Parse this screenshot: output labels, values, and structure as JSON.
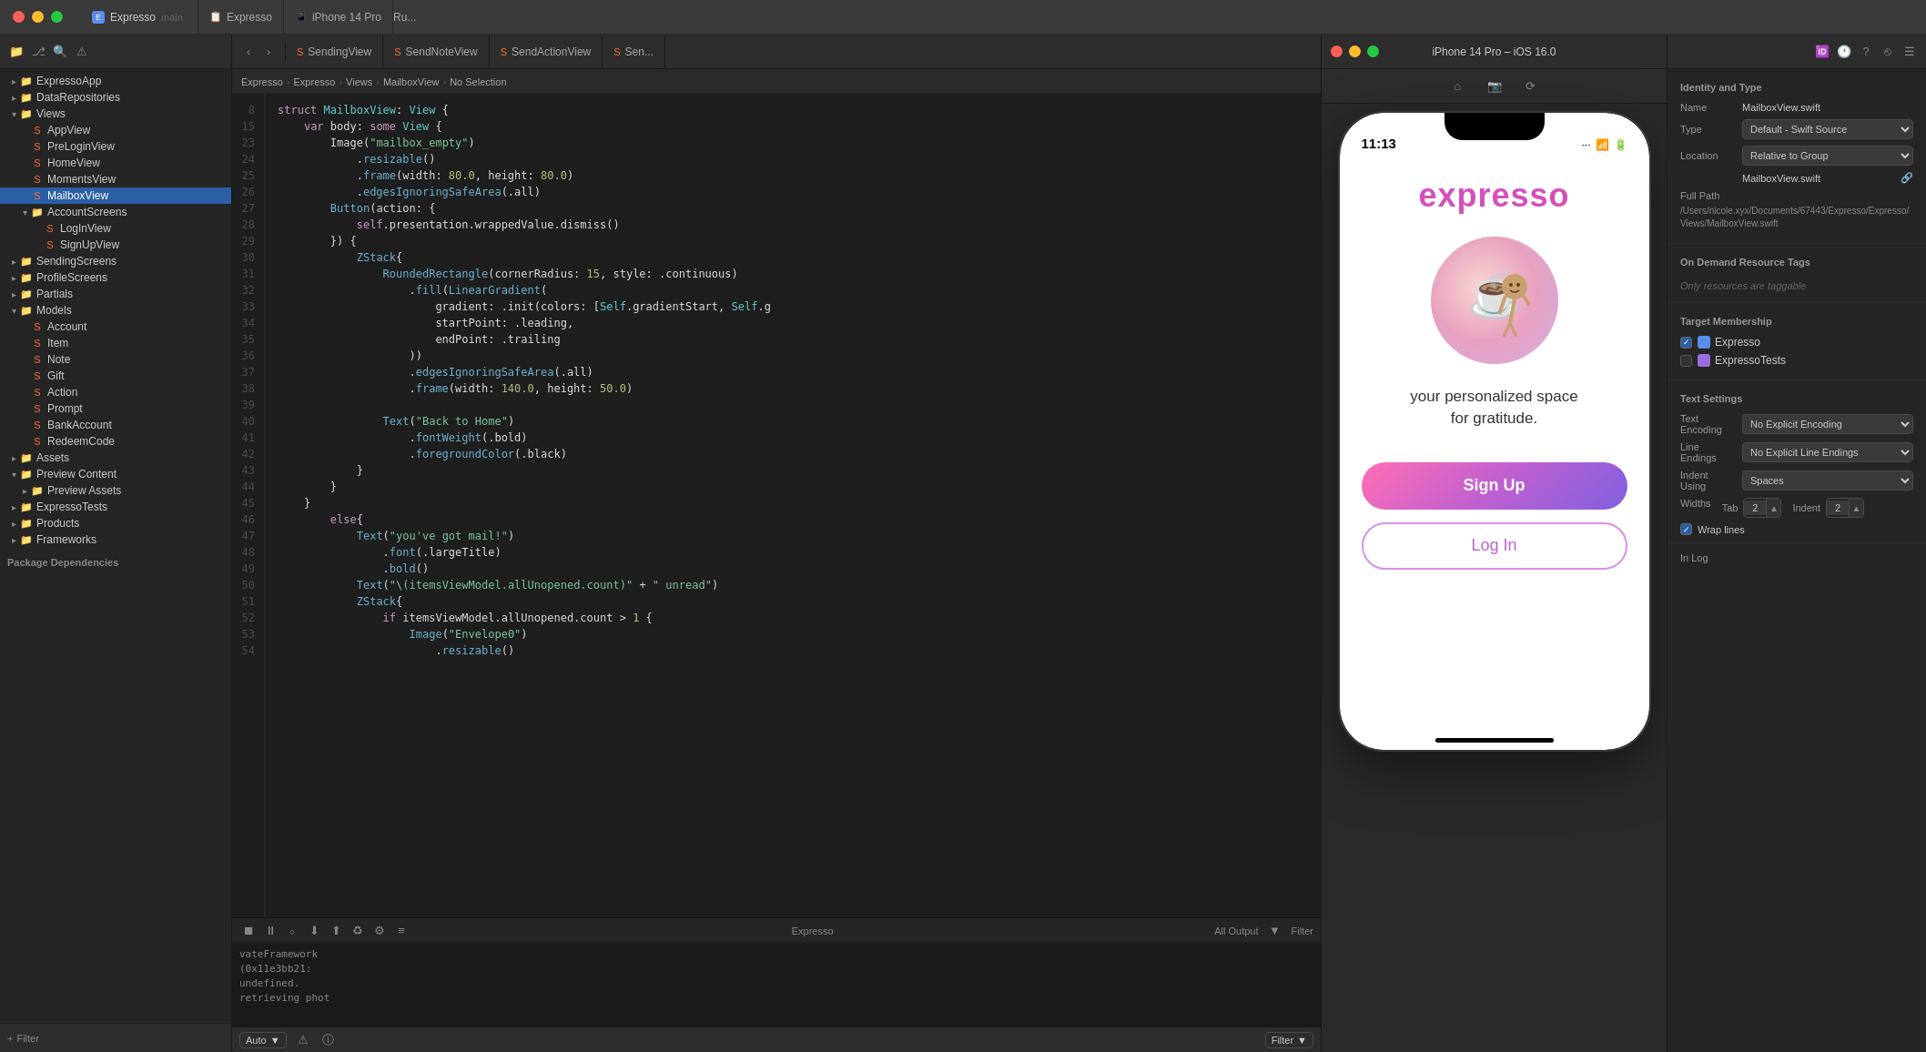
{
  "titleBar": {
    "project": {
      "name": "Expresso",
      "branch": "main",
      "icon": "E"
    },
    "tabs": [
      {
        "label": "Expresso",
        "icon": "📋"
      },
      {
        "label": "iPhone 14 Pro",
        "icon": "📱"
      }
    ],
    "runLabel": "Ru..."
  },
  "leftSidebar": {
    "toolbar": {
      "icons": [
        "folder-icon",
        "git-icon",
        "search-icon",
        "warning-icon"
      ]
    },
    "tree": [
      {
        "label": "ExpressoApp",
        "type": "folder",
        "depth": 0,
        "expanded": false
      },
      {
        "label": "DataRepositories",
        "type": "folder",
        "depth": 0,
        "expanded": false
      },
      {
        "label": "Views",
        "type": "folder",
        "depth": 0,
        "expanded": true
      },
      {
        "label": "AppView",
        "type": "swift",
        "depth": 1
      },
      {
        "label": "PreLoginView",
        "type": "swift",
        "depth": 1
      },
      {
        "label": "HomeView",
        "type": "swift",
        "depth": 1
      },
      {
        "label": "MomentsView",
        "type": "swift",
        "depth": 1
      },
      {
        "label": "MailboxView",
        "type": "swift",
        "depth": 1,
        "selected": true
      },
      {
        "label": "AccountScreens",
        "type": "folder",
        "depth": 1,
        "expanded": true
      },
      {
        "label": "LogInView",
        "type": "swift",
        "depth": 2
      },
      {
        "label": "SignUpView",
        "type": "swift",
        "depth": 2
      },
      {
        "label": "SendingScreens",
        "type": "folder",
        "depth": 0,
        "expanded": false
      },
      {
        "label": "ProfileScreens",
        "type": "folder",
        "depth": 0,
        "expanded": false
      },
      {
        "label": "Partials",
        "type": "folder",
        "depth": 0,
        "expanded": false
      },
      {
        "label": "Models",
        "type": "folder",
        "depth": 0,
        "expanded": true
      },
      {
        "label": "Account",
        "type": "swift",
        "depth": 1
      },
      {
        "label": "Item",
        "type": "swift",
        "depth": 1
      },
      {
        "label": "Note",
        "type": "swift",
        "depth": 1
      },
      {
        "label": "Gift",
        "type": "swift",
        "depth": 1
      },
      {
        "label": "Action",
        "type": "swift",
        "depth": 1
      },
      {
        "label": "Prompt",
        "type": "swift",
        "depth": 1
      },
      {
        "label": "BankAccount",
        "type": "swift",
        "depth": 1
      },
      {
        "label": "RedeemCode",
        "type": "swift",
        "depth": 1
      },
      {
        "label": "Assets",
        "type": "folder",
        "depth": 0,
        "expanded": false
      },
      {
        "label": "Preview Content",
        "type": "folder",
        "depth": 0,
        "expanded": true
      },
      {
        "label": "Preview Assets",
        "type": "folder",
        "depth": 1,
        "expanded": false
      },
      {
        "label": "ExpressoTests",
        "type": "folder",
        "depth": 0,
        "expanded": false
      },
      {
        "label": "Products",
        "type": "folder",
        "depth": 0,
        "expanded": false
      },
      {
        "label": "Frameworks",
        "type": "folder",
        "depth": 0,
        "expanded": false
      }
    ],
    "footer": {
      "addLabel": "+ Filter",
      "filterLabel": "Filter"
    }
  },
  "editor": {
    "tabs": [
      {
        "label": "SendingView",
        "icon": "S"
      },
      {
        "label": "SendNoteView",
        "icon": "S"
      },
      {
        "label": "SendActionView",
        "icon": "S"
      },
      {
        "label": "Sen...",
        "icon": "S"
      }
    ],
    "breadcrumb": [
      "Expresso",
      "Expresso",
      "Views",
      "MailboxView",
      "No Selection"
    ],
    "lines": [
      {
        "num": "8",
        "code": "struct MailboxView: View {",
        "tokens": [
          {
            "t": "kw",
            "v": "struct "
          },
          {
            "t": "type",
            "v": "MailboxView"
          },
          {
            "t": "plain",
            "v": ": "
          },
          {
            "t": "type",
            "v": "View"
          },
          {
            "t": "plain",
            "v": " {"
          }
        ]
      },
      {
        "num": "15",
        "code": "    var body: some View {",
        "tokens": [
          {
            "t": "plain",
            "v": "    "
          },
          {
            "t": "kw",
            "v": "var "
          },
          {
            "t": "plain",
            "v": "body: "
          },
          {
            "t": "kw",
            "v": "some "
          },
          {
            "t": "type",
            "v": "View"
          },
          {
            "t": "plain",
            "v": " {"
          }
        ]
      },
      {
        "num": "23",
        "code": "        Image(\"mailbox_empty\")",
        "tokens": [
          {
            "t": "plain",
            "v": "        "
          },
          {
            "t": "fn",
            "v": "Image"
          },
          {
            "t": "plain",
            "v": "("
          },
          {
            "t": "str",
            "v": "\"mailbox_empty\""
          },
          {
            "t": "plain",
            "v": ")"
          }
        ]
      },
      {
        "num": "24",
        "code": "            .resizable()",
        "tokens": [
          {
            "t": "plain",
            "v": "            ."
          },
          {
            "t": "fn",
            "v": "resizable"
          },
          {
            "t": "plain",
            "v": "()"
          }
        ]
      },
      {
        "num": "25",
        "code": "            .frame(width: 80.0, height: 80.0)",
        "tokens": [
          {
            "t": "plain",
            "v": "            ."
          },
          {
            "t": "fn",
            "v": "frame"
          },
          {
            "t": "plain",
            "v": "(width: "
          },
          {
            "t": "num",
            "v": "80.0"
          },
          {
            "t": "plain",
            "v": ", height: "
          },
          {
            "t": "num",
            "v": "80.0"
          },
          {
            "t": "plain",
            "v": ")"
          }
        ]
      },
      {
        "num": "26",
        "code": "            .edgesIgnoringSafeArea(.all)",
        "tokens": [
          {
            "t": "plain",
            "v": "            ."
          },
          {
            "t": "fn",
            "v": "edgesIgnoringSafeArea"
          },
          {
            "t": "plain",
            "v": "(.all)"
          }
        ]
      },
      {
        "num": "27",
        "code": "        Button(action: {",
        "tokens": [
          {
            "t": "plain",
            "v": "        "
          },
          {
            "t": "fn",
            "v": "Button"
          },
          {
            "t": "plain",
            "v": "(action: {"
          }
        ]
      },
      {
        "num": "28",
        "code": "            self.presentation.wrappedValue.dismiss()",
        "tokens": [
          {
            "t": "plain",
            "v": "            "
          },
          {
            "t": "kw",
            "v": "self"
          },
          {
            "t": "plain",
            "v": ".presentation.wrappedValue.dismiss()"
          }
        ]
      },
      {
        "num": "29",
        "code": "        }) {",
        "tokens": [
          {
            "t": "plain",
            "v": "        }) {"
          }
        ]
      },
      {
        "num": "30",
        "code": "            ZStack{",
        "tokens": [
          {
            "t": "plain",
            "v": "            "
          },
          {
            "t": "fn",
            "v": "ZStack"
          },
          {
            "t": "plain",
            "v": "{"
          }
        ]
      },
      {
        "num": "31",
        "code": "                RoundedRectangle(cornerRadius: 15, style: .continuous)",
        "tokens": [
          {
            "t": "plain",
            "v": "                "
          },
          {
            "t": "fn",
            "v": "RoundedRectangle"
          },
          {
            "t": "plain",
            "v": "(cornerRadius: "
          },
          {
            "t": "num",
            "v": "15"
          },
          {
            "t": "plain",
            "v": ", style: .continuous)"
          }
        ]
      },
      {
        "num": "32",
        "code": "                    .fill(LinearGradient(",
        "tokens": [
          {
            "t": "plain",
            "v": "                    ."
          },
          {
            "t": "fn",
            "v": "fill"
          },
          {
            "t": "plain",
            "v": "("
          },
          {
            "t": "fn",
            "v": "LinearGradient"
          },
          {
            "t": "plain",
            "v": "("
          }
        ]
      },
      {
        "num": "33",
        "code": "                        gradient: .init(colors: [Self.gradientStart, Self.g",
        "tokens": [
          {
            "t": "plain",
            "v": "                        gradient: .init(colors: ["
          },
          {
            "t": "type",
            "v": "Self"
          },
          {
            "t": "plain",
            "v": ".gradientStart, "
          },
          {
            "t": "type",
            "v": "Self"
          },
          {
            "t": "plain",
            "v": ".g"
          }
        ]
      },
      {
        "num": "34",
        "code": "                        startPoint: .leading,",
        "tokens": [
          {
            "t": "plain",
            "v": "                        startPoint: .leading,"
          }
        ]
      },
      {
        "num": "35",
        "code": "                        endPoint: .trailing",
        "tokens": [
          {
            "t": "plain",
            "v": "                        endPoint: .trailing"
          }
        ]
      },
      {
        "num": "36",
        "code": "                    ))",
        "tokens": [
          {
            "t": "plain",
            "v": "                    ))"
          }
        ]
      },
      {
        "num": "37",
        "code": "                    .edgesIgnoringSafeArea(.all)",
        "tokens": [
          {
            "t": "plain",
            "v": "                    ."
          },
          {
            "t": "fn",
            "v": "edgesIgnoringSafeArea"
          },
          {
            "t": "plain",
            "v": "(.all)"
          }
        ]
      },
      {
        "num": "38",
        "code": "                    .frame(width: 140.0, height: 50.0)",
        "tokens": [
          {
            "t": "plain",
            "v": "                    ."
          },
          {
            "t": "fn",
            "v": "frame"
          },
          {
            "t": "plain",
            "v": "(width: "
          },
          {
            "t": "num",
            "v": "140.0"
          },
          {
            "t": "plain",
            "v": ", height: "
          },
          {
            "t": "num",
            "v": "50.0"
          },
          {
            "t": "plain",
            "v": ")"
          }
        ]
      },
      {
        "num": "39",
        "code": "",
        "tokens": []
      },
      {
        "num": "40",
        "code": "                Text(\"Back to Home\")",
        "tokens": [
          {
            "t": "plain",
            "v": "                "
          },
          {
            "t": "fn",
            "v": "Text"
          },
          {
            "t": "plain",
            "v": "("
          },
          {
            "t": "str",
            "v": "\"Back to Home\""
          },
          {
            "t": "plain",
            "v": ")"
          }
        ]
      },
      {
        "num": "41",
        "code": "                    .fontWeight(.bold)",
        "tokens": [
          {
            "t": "plain",
            "v": "                    ."
          },
          {
            "t": "fn",
            "v": "fontWeight"
          },
          {
            "t": "plain",
            "v": "(.bold)"
          }
        ]
      },
      {
        "num": "42",
        "code": "                    .foregroundColor(.black)",
        "tokens": [
          {
            "t": "plain",
            "v": "                    ."
          },
          {
            "t": "fn",
            "v": "foregroundColor"
          },
          {
            "t": "plain",
            "v": "(.black)"
          }
        ]
      },
      {
        "num": "43",
        "code": "            }",
        "tokens": [
          {
            "t": "plain",
            "v": "            }"
          }
        ]
      },
      {
        "num": "44",
        "code": "        }",
        "tokens": [
          {
            "t": "plain",
            "v": "        }"
          }
        ]
      },
      {
        "num": "45",
        "code": "    }",
        "tokens": [
          {
            "t": "plain",
            "v": "    }"
          }
        ]
      },
      {
        "num": "46",
        "code": "        else{",
        "tokens": [
          {
            "t": "plain",
            "v": "        "
          },
          {
            "t": "kw",
            "v": "else"
          },
          {
            "t": "plain",
            "v": "{"
          }
        ]
      },
      {
        "num": "47",
        "code": "            Text(\"you've got mail!\")",
        "tokens": [
          {
            "t": "plain",
            "v": "            "
          },
          {
            "t": "fn",
            "v": "Text"
          },
          {
            "t": "plain",
            "v": "("
          },
          {
            "t": "str",
            "v": "\"you've got mail!\""
          },
          {
            "t": "plain",
            "v": ")"
          }
        ]
      },
      {
        "num": "48",
        "code": "                .font(.largeTitle)",
        "tokens": [
          {
            "t": "plain",
            "v": "                ."
          },
          {
            "t": "fn",
            "v": "font"
          },
          {
            "t": "plain",
            "v": "(.largeTitle)"
          }
        ]
      },
      {
        "num": "49",
        "code": "                .bold()",
        "tokens": [
          {
            "t": "plain",
            "v": "                ."
          },
          {
            "t": "fn",
            "v": "bold"
          },
          {
            "t": "plain",
            "v": "()"
          }
        ]
      },
      {
        "num": "50",
        "code": "            Text(\"\\(itemsViewModel.allUnopened.count)\" + \" unread\")",
        "tokens": [
          {
            "t": "plain",
            "v": "            "
          },
          {
            "t": "fn",
            "v": "Text"
          },
          {
            "t": "plain",
            "v": "("
          },
          {
            "t": "str",
            "v": "\"\\(itemsViewModel.allUnopened.count)\""
          },
          {
            "t": "plain",
            "v": " + "
          },
          {
            "t": "str",
            "v": "\" unread\""
          },
          {
            "t": "plain",
            "v": ")"
          }
        ]
      },
      {
        "num": "51",
        "code": "            ZStack{",
        "tokens": [
          {
            "t": "plain",
            "v": "            "
          },
          {
            "t": "fn",
            "v": "ZStack"
          },
          {
            "t": "plain",
            "v": "{"
          }
        ]
      },
      {
        "num": "52",
        "code": "                if itemsViewModel.allUnopened.count > 1 {",
        "tokens": [
          {
            "t": "plain",
            "v": "                "
          },
          {
            "t": "kw",
            "v": "if "
          },
          {
            "t": "plain",
            "v": "itemsViewModel.allUnopened.count > "
          },
          {
            "t": "num",
            "v": "1"
          },
          {
            "t": "plain",
            "v": " {"
          }
        ]
      },
      {
        "num": "53",
        "code": "                    Image(\"Envelope0\")",
        "tokens": [
          {
            "t": "plain",
            "v": "                    "
          },
          {
            "t": "fn",
            "v": "Image"
          },
          {
            "t": "plain",
            "v": "("
          },
          {
            "t": "str",
            "v": "\"Envelope0\""
          },
          {
            "t": "plain",
            "v": ")"
          }
        ]
      },
      {
        "num": "54",
        "code": "                        .resizable()",
        "tokens": [
          {
            "t": "plain",
            "v": "                        ."
          },
          {
            "t": "fn",
            "v": "resizable"
          },
          {
            "t": "plain",
            "v": "()"
          }
        ]
      }
    ],
    "output": {
      "content": "vateFramework\n(0x11e3bb21: undefined.\nretrieving phot"
    }
  },
  "simulator": {
    "title": "iPhone 14 Pro – iOS 16.0",
    "windowTitle": "iPhone 14 Pro – iOS 16.0",
    "phone": {
      "time": "11:13",
      "appName": "expresso",
      "tagline": "your personalized space\nfor gratitude.",
      "signUpLabel": "Sign Up",
      "logInLabel": "Log In"
    },
    "bottomIcons": [
      "home-icon",
      "camera-icon",
      "share-icon"
    ]
  },
  "rightPanel": {
    "title": "Identity and Type",
    "fields": [
      {
        "label": "Name",
        "value": "MailboxView.swift"
      },
      {
        "label": "Type",
        "value": "Default - Swift Source"
      },
      {
        "label": "Location",
        "value": "Relative to Group"
      }
    ],
    "filename": "MailboxView.swift",
    "fullPath": "/Users/nicole.xyx/Documents/67443/Expresso/Expresso/Views/MailboxView.swift",
    "onDemandSection": {
      "title": "On Demand Resource Tags",
      "placeholder": "Only resources are taggable"
    },
    "targetMembership": {
      "title": "Target Membership",
      "items": [
        {
          "label": "Expresso",
          "checked": true,
          "iconColor": "blue"
        },
        {
          "label": "ExpressoTests",
          "checked": false,
          "iconColor": "purple"
        }
      ]
    },
    "textSettings": {
      "title": "Text Settings",
      "encodingLabel": "Text Encoding",
      "encodingValue": "No Explicit Encoding",
      "lineEndingsLabel": "Line Endings",
      "lineEndingsValue": "No Explicit Line Endings",
      "indentUsingLabel": "Indent Using",
      "indentUsingValue": "Spaces",
      "widthsLabel": "Widths",
      "tabLabel": "Tab",
      "tabValue": "2",
      "indentLabel": "Indent",
      "indentValue": "2",
      "wrapLines": "Wrap lines"
    },
    "inLog": {
      "title": "In Log"
    }
  },
  "statusBar": {
    "autoLabel": "Auto",
    "filterLabel": "Filter",
    "allOutputLabel": "All Output",
    "filterLabel2": "Filter"
  }
}
